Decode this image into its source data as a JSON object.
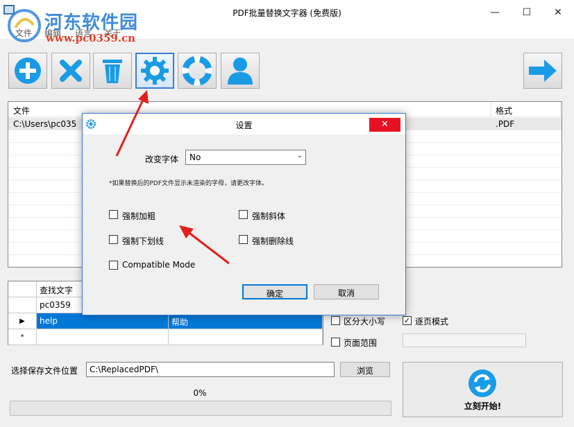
{
  "window": {
    "title": "PDF批量替换文字器 (免费版)",
    "min": "—",
    "max": "☐",
    "close": "✕"
  },
  "watermark": {
    "title": "河东软件园",
    "url": "www.pc0359.cn"
  },
  "menu": [
    "文件",
    "编辑",
    "语言",
    "关于"
  ],
  "toolbar": {
    "buttons": [
      {
        "name": "add-icon",
        "color": "#1a9be6"
      },
      {
        "name": "remove-icon",
        "color": "#1a9be6"
      },
      {
        "name": "trash-icon",
        "color": "#1a9be6"
      },
      {
        "name": "gear-icon",
        "color": "#1a9be6"
      },
      {
        "name": "lifebuoy-icon",
        "color": "#1a9be6"
      },
      {
        "name": "user-icon",
        "color": "#1a9be6"
      },
      {
        "name": "arrow-right-icon",
        "color": "#1a9be6"
      }
    ]
  },
  "filelist": {
    "col_file": "文件",
    "col_format": "格式",
    "rows": [
      {
        "file": "C:\\Users\\pc035",
        "format": ".PDF"
      }
    ]
  },
  "grid": {
    "col_find": "查找文字",
    "rows": [
      {
        "marker": "",
        "find": "pc0359",
        "replace": ""
      },
      {
        "marker": "▶",
        "find": "help",
        "replace": "帮助"
      },
      {
        "marker": "*",
        "find": "",
        "replace": ""
      }
    ]
  },
  "options": {
    "case_sensitive": "区分大小写",
    "page_mode": "逐页模式",
    "page_mode_checked": "✓",
    "page_range": "页面范围"
  },
  "save": {
    "label": "选择保存文件位置",
    "path": "C:\\ReplacedPDF\\",
    "browse": "浏览"
  },
  "progress": {
    "value": 0,
    "label": "0%"
  },
  "start": {
    "label": "立刻开始!"
  },
  "dialog": {
    "title": "设置",
    "close": "✕",
    "font_label": "改变字体",
    "font_value": "No",
    "note": "*如果替换后的PDF文件显示未渲染的字母，请更改字体。",
    "checkboxes": [
      "强制加粗",
      "强制斜体",
      "强制下划线",
      "强制删除线",
      "Compatible Mode"
    ],
    "ok": "确定",
    "cancel": "取消"
  },
  "colors": {
    "accent": "#1a9be6",
    "selection": "#0078d7",
    "annotation_arrow": "#e0201b"
  }
}
